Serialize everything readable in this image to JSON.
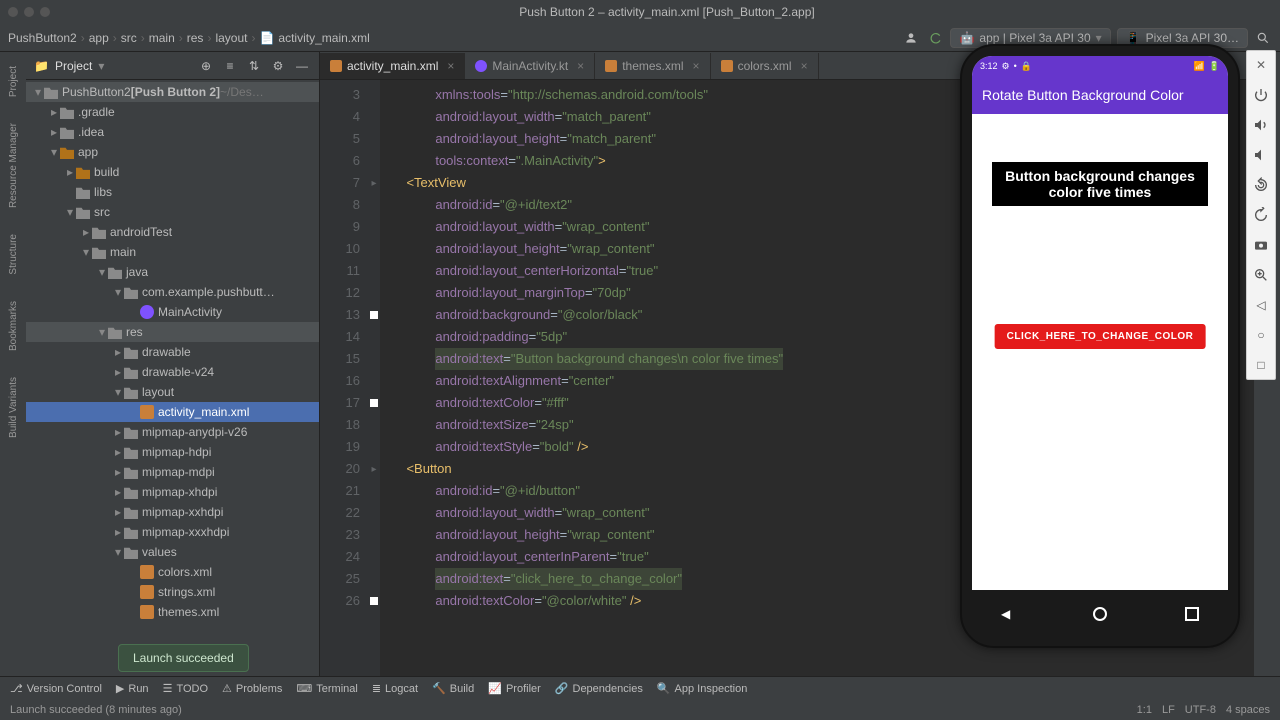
{
  "window": {
    "title": "Push Button 2 – activity_main.xml [Push_Button_2.app]"
  },
  "breadcrumb": [
    "PushButton2",
    "app",
    "src",
    "main",
    "res",
    "layout",
    "activity_main.xml"
  ],
  "runConfig": {
    "label": "app | Pixel 3a API 30",
    "device": "Pixel 3a API 30…"
  },
  "leftRail": [
    "Project",
    "Resource Manager",
    "Structure",
    "Bookmarks",
    "Build Variants"
  ],
  "projectPanel": {
    "title": "Project"
  },
  "tree": [
    {
      "ind": 0,
      "chev": "▾",
      "ico": "folder",
      "txt": "PushButton2",
      "extra": "[Push Button 2]",
      "dim": "~/Des…",
      "hl": true
    },
    {
      "ind": 1,
      "chev": "▸",
      "ico": "folder",
      "txt": ".gradle"
    },
    {
      "ind": 1,
      "chev": "▸",
      "ico": "folder",
      "txt": ".idea"
    },
    {
      "ind": 1,
      "chev": "▾",
      "ico": "folder-o",
      "txt": "app"
    },
    {
      "ind": 2,
      "chev": "▸",
      "ico": "folder-o",
      "txt": "build"
    },
    {
      "ind": 2,
      "chev": "",
      "ico": "folder",
      "txt": "libs"
    },
    {
      "ind": 2,
      "chev": "▾",
      "ico": "folder",
      "txt": "src"
    },
    {
      "ind": 3,
      "chev": "▸",
      "ico": "folder",
      "txt": "androidTest"
    },
    {
      "ind": 3,
      "chev": "▾",
      "ico": "folder",
      "txt": "main"
    },
    {
      "ind": 4,
      "chev": "▾",
      "ico": "folder",
      "txt": "java"
    },
    {
      "ind": 5,
      "chev": "▾",
      "ico": "folder",
      "txt": "com.example.pushbutt…"
    },
    {
      "ind": 6,
      "chev": "",
      "ico": "kt",
      "txt": "MainActivity"
    },
    {
      "ind": 4,
      "chev": "▾",
      "ico": "folder",
      "txt": "res",
      "hl": true
    },
    {
      "ind": 5,
      "chev": "▸",
      "ico": "folder",
      "txt": "drawable"
    },
    {
      "ind": 5,
      "chev": "▸",
      "ico": "folder",
      "txt": "drawable-v24"
    },
    {
      "ind": 5,
      "chev": "▾",
      "ico": "folder",
      "txt": "layout"
    },
    {
      "ind": 6,
      "chev": "",
      "ico": "xml",
      "txt": "activity_main.xml",
      "sel": true
    },
    {
      "ind": 5,
      "chev": "▸",
      "ico": "folder",
      "txt": "mipmap-anydpi-v26"
    },
    {
      "ind": 5,
      "chev": "▸",
      "ico": "folder",
      "txt": "mipmap-hdpi"
    },
    {
      "ind": 5,
      "chev": "▸",
      "ico": "folder",
      "txt": "mipmap-mdpi"
    },
    {
      "ind": 5,
      "chev": "▸",
      "ico": "folder",
      "txt": "mipmap-xhdpi"
    },
    {
      "ind": 5,
      "chev": "▸",
      "ico": "folder",
      "txt": "mipmap-xxhdpi"
    },
    {
      "ind": 5,
      "chev": "▸",
      "ico": "folder",
      "txt": "mipmap-xxxhdpi"
    },
    {
      "ind": 5,
      "chev": "▾",
      "ico": "folder",
      "txt": "values"
    },
    {
      "ind": 6,
      "chev": "",
      "ico": "xml",
      "txt": "colors.xml"
    },
    {
      "ind": 6,
      "chev": "",
      "ico": "xml",
      "txt": "strings.xml"
    },
    {
      "ind": 6,
      "chev": "",
      "ico": "xml",
      "txt": "themes.xml"
    }
  ],
  "tabs": [
    {
      "label": "activity_main.xml",
      "ico": "xml",
      "act": true
    },
    {
      "label": "MainActivity.kt",
      "ico": "kt"
    },
    {
      "label": "themes.xml",
      "ico": "xml"
    },
    {
      "label": "colors.xml",
      "ico": "xml"
    }
  ],
  "code": {
    "start": 3,
    "lines": [
      {
        "n": 3,
        "t": "            <span class=at>xmlns:tools</span>=<span class=st>\"http://schemas.android.com/tools\"</span>"
      },
      {
        "n": 4,
        "t": "            <span class=at>android:layout_width</span>=<span class=st>\"match_parent\"</span>"
      },
      {
        "n": 5,
        "t": "            <span class=at>android:layout_height</span>=<span class=st>\"match_parent\"</span>"
      },
      {
        "n": 6,
        "t": "            <span class=at>tools:context</span>=<span class=st>\".MainActivity\"</span><span class=tg>&gt;</span>"
      },
      {
        "n": 7,
        "t": "    <span class=tg>&lt;TextView</span>",
        "fold": "▸"
      },
      {
        "n": 8,
        "t": "            <span class=at>android:id</span>=<span class=st>\"@+id/text2\"</span>"
      },
      {
        "n": 9,
        "t": "            <span class=at>android:layout_width</span>=<span class=st>\"wrap_content\"</span>"
      },
      {
        "n": 10,
        "t": "            <span class=at>android:layout_height</span>=<span class=st>\"wrap_content\"</span>"
      },
      {
        "n": 11,
        "t": "            <span class=at>android:layout_centerHorizontal</span>=<span class=st>\"true\"</span>"
      },
      {
        "n": 12,
        "t": "            <span class=at>android:layout_marginTop</span>=<span class=st>\"70dp\"</span>"
      },
      {
        "n": 13,
        "t": "            <span class=at>android:background</span>=<span class=st>\"@color/black\"</span>",
        "bp": true
      },
      {
        "n": 14,
        "t": "            <span class=at>android:padding</span>=<span class=st>\"5dp\"</span>"
      },
      {
        "n": 15,
        "t": "            <span class='hl-line'><span class=at>android:text</span>=<span class=st>\"Button background changes\\n color five times\"</span></span>"
      },
      {
        "n": 16,
        "t": "            <span class=at>android:textAlignment</span>=<span class=st>\"center\"</span>"
      },
      {
        "n": 17,
        "t": "            <span class=at>android:textColor</span>=<span class=st>\"#fff\"</span>",
        "bp": true
      },
      {
        "n": 18,
        "t": "            <span class=at>android:textSize</span>=<span class=st>\"24sp\"</span>"
      },
      {
        "n": 19,
        "t": "            <span class=at>android:textStyle</span>=<span class=st>\"bold\"</span> <span class=tg>/&gt;</span>"
      },
      {
        "n": 20,
        "t": "    <span class=tg>&lt;Button</span>",
        "fold": "▸"
      },
      {
        "n": 21,
        "t": "            <span class=at>android:id</span>=<span class=st>\"@+id/button\"</span>"
      },
      {
        "n": 22,
        "t": "            <span class=at>android:layout_width</span>=<span class=st>\"wrap_content\"</span>"
      },
      {
        "n": 23,
        "t": "            <span class=at>android:layout_height</span>=<span class=st>\"wrap_content\"</span>"
      },
      {
        "n": 24,
        "t": "            <span class=at>android:layout_centerInParent</span>=<span class=st>\"true\"</span>"
      },
      {
        "n": 25,
        "t": "            <span class='hl-line'><span class=at>android:text</span>=<span class=st>\"click_here_to_change_color\"</span></span>"
      },
      {
        "n": 26,
        "t": "            <span class=at>android:textColor</span>=<span class=st>\"@color/white\"</span> <span class=tg>/&gt;</span>",
        "bp": true
      }
    ]
  },
  "emulator": {
    "time": "3:12",
    "appTitle": "Rotate Button Background Color",
    "tv": "Button background changes color five times",
    "btn": "CLICK_HERE_TO_CHANGE_COLOR"
  },
  "toast": "Launch succeeded",
  "bottom": [
    "Version Control",
    "Run",
    "TODO",
    "Problems",
    "Terminal",
    "Logcat",
    "Build",
    "Profiler",
    "Dependencies",
    "App Inspection"
  ],
  "status": {
    "left": "Launch succeeded (8 minutes ago)",
    "right": [
      "1:1",
      "LF",
      "UTF-8",
      "4 spaces"
    ]
  }
}
